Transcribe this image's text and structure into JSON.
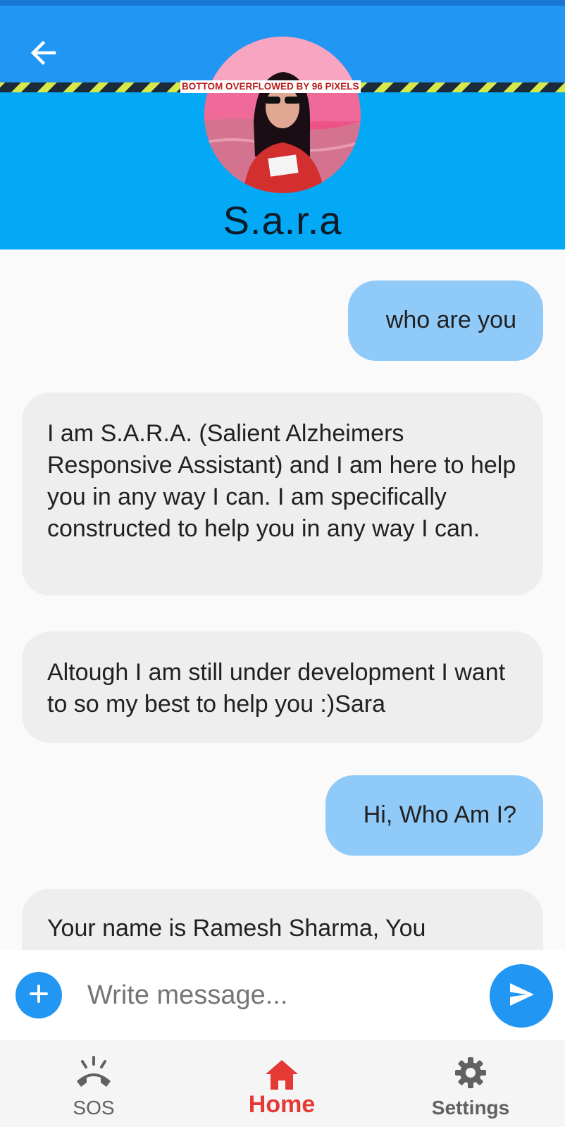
{
  "app_bar": {
    "back_icon": "arrow-left-icon",
    "overflow_warning": "BOTTOM OVERFLOWED BY 96 PIXELS",
    "bot_name": "S.a.r.a"
  },
  "messages": [
    {
      "sender": "user",
      "text": "who are you"
    },
    {
      "sender": "bot",
      "text": "I am S.A.R.A. (Salient Alzheimers Responsive Assistant) and I am here to help you in any way I can. I am specifically constructed to help you in any way I can."
    },
    {
      "sender": "bot",
      "text": "Altough I am still under development I want to so my best to help you :)Sara"
    },
    {
      "sender": "user",
      "text": "Hi, Who Am I?"
    },
    {
      "sender": "bot",
      "text": "Your name is Ramesh Sharma, You"
    }
  ],
  "composer": {
    "placeholder": "Write message...",
    "attach_icon": "plus-icon",
    "send_icon": "send-icon"
  },
  "bottom_nav": {
    "items": [
      {
        "label": "SOS",
        "icon": "phone-alert-icon",
        "active": false
      },
      {
        "label": "Home",
        "icon": "home-icon",
        "active": true
      },
      {
        "label": "Settings",
        "icon": "gear-icon",
        "active": false
      }
    ]
  },
  "colors": {
    "app_bar": "#2196f3",
    "header_lower": "#03a9f4",
    "user_bubble": "#90caf9",
    "bot_bubble": "#eeeeee",
    "nav_active": "#e53935",
    "nav_inactive": "#616161"
  }
}
